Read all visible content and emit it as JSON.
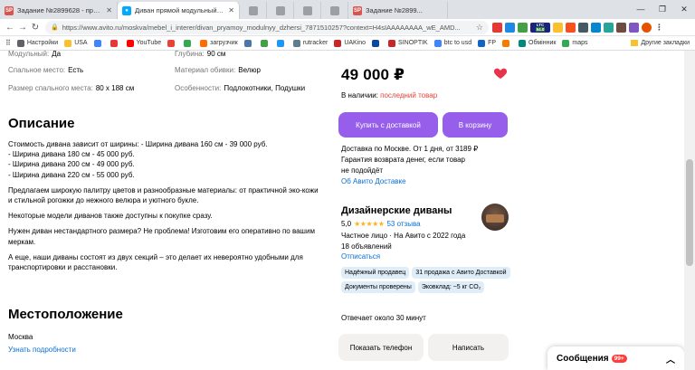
{
  "browser": {
    "tabs": [
      {
        "label": "Задание №2899628 - просмотр з...",
        "fav": "SP",
        "color": "#d9534f"
      },
      {
        "label": "Диван прямой модульный Джерси...",
        "fav": "A",
        "color": "#00aaff"
      },
      {
        "label": "",
        "fav": "",
        "color": "#9aa0a6"
      },
      {
        "label": "",
        "fav": "",
        "color": "#9aa0a6"
      },
      {
        "label": "Задание №2899...",
        "fav": "SP",
        "color": "#d9534f"
      }
    ],
    "url": "https://www.avito.ru/moskva/mebel_i_interer/divan_pryamoy_modulnyy_dzhersi_7871510257?context=H4sIAAAAAAAA_wE_AMD...",
    "bookmarks": [
      "Настройки",
      "USA",
      "YouTube",
      "загрузчик",
      "rutracker",
      "UAKino",
      "SINOPTIK",
      "btc to usd",
      "FP",
      "Обмінник",
      "maps"
    ],
    "other_bookmarks": "Другие закладки",
    "ltc": "LTC",
    "ltc_value": "54.0"
  },
  "properties": {
    "rows": [
      {
        "k1": "Модульный:",
        "v1": "Да",
        "k2": "Глубина:",
        "v2": "90 см"
      },
      {
        "k1": "Спальное место:",
        "v1": "Есть",
        "k2": "Материал обивки:",
        "v2": "Велюр"
      },
      {
        "k1": "Размер спального места:",
        "v1": "80 х 188 см",
        "k2": "Особенности:",
        "v2": "Подлокотники, Подушки"
      }
    ]
  },
  "description": {
    "title": "Описание",
    "p1": [
      "Стоимость дивана зависит от ширины: - Ширина дивана 160 см - 39 000 руб.",
      "- Ширина дивана 180 см - 45 000 руб.",
      "- Ширина дивана 200 см - 49 000 руб.",
      "- Ширина дивана 220 см - 55 000 руб."
    ],
    "p2": "Предлагаем широкую палитру цветов и разнообразные материалы: от практичной эко-кожи и стильной рогожки до нежного велюра и уютного букле.",
    "p3": "Некоторые модели диванов также доступны к покупке сразу.",
    "p4": "Нужен диван нестандартного размера? Не проблема! Изготовим его оперативно по вашим меркам.",
    "p5": "А еще, наши диваны состоят из двух секций – это делает их невероятно удобными для транспортировки и расстановки."
  },
  "location": {
    "title": "Местоположение",
    "city": "Москва",
    "link": "Узнать подробности"
  },
  "offer": {
    "price": "49 000 ₽",
    "avail_prefix": "В наличии:",
    "avail_value": "последний товар",
    "buy_label": "Купить с доставкой",
    "cart_label": "В корзину",
    "delivery": [
      "Доставка по Москве. От 1 дня, от 3189 ₽",
      "Гарантия возврата денег, если товар",
      "не подойдёт"
    ],
    "delivery_link": "Об Авито Доставке"
  },
  "seller": {
    "name": "Дизайнерские диваны",
    "rating": "5,0",
    "stars": "★★★★★",
    "reviews": "53 отзыва",
    "info1": "Частное лицо · На Авито с 2022 года",
    "info2": "18 объявлений",
    "subscribe": "Отписаться",
    "badges": [
      "Надёжный продавец",
      "31 продажа с Авито Доставкой",
      "Документы проверены",
      "Эковклад: ~5 кг CO₂"
    ],
    "reply": "Отвечает около 30 минут",
    "phone_label": "Показать телефон",
    "message_label": "Написать"
  },
  "messages": {
    "label": "Сообщения",
    "count": "99+"
  },
  "colors": {
    "accent": "#965eeb",
    "link": "#0a6fd8",
    "alert": "#e8443a"
  }
}
